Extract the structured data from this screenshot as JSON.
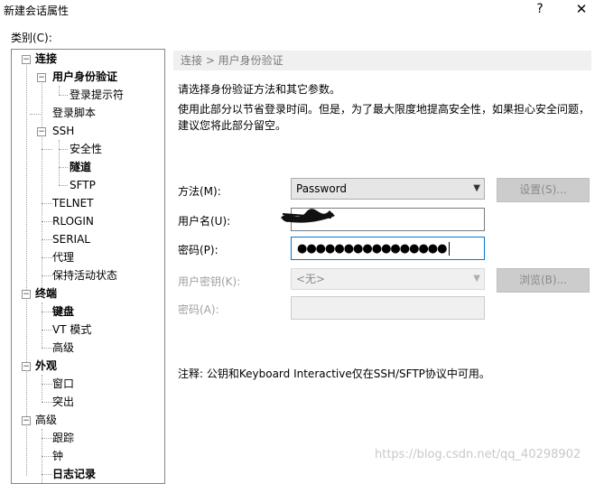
{
  "window": {
    "title": "新建会话属性",
    "help": "?",
    "close": "✕"
  },
  "category_label": "类别(C):",
  "tree": {
    "items": [
      {
        "label": "连接",
        "bold": true
      },
      {
        "label": "用户身份验证",
        "bold": true,
        "selected": true
      },
      {
        "label": "登录提示符"
      },
      {
        "label": "登录脚本"
      },
      {
        "label": "SSH"
      },
      {
        "label": "安全性"
      },
      {
        "label": "隧道",
        "bold": true
      },
      {
        "label": "SFTP"
      },
      {
        "label": "TELNET"
      },
      {
        "label": "RLOGIN"
      },
      {
        "label": "SERIAL"
      },
      {
        "label": "代理"
      },
      {
        "label": "保持活动状态"
      },
      {
        "label": "终端",
        "bold": true
      },
      {
        "label": "键盘",
        "bold": true
      },
      {
        "label": "VT 模式"
      },
      {
        "label": "高级"
      },
      {
        "label": "外观",
        "bold": true
      },
      {
        "label": "窗口"
      },
      {
        "label": "突出"
      },
      {
        "label": "高级"
      },
      {
        "label": "跟踪"
      },
      {
        "label": "钟"
      },
      {
        "label": "日志记录"
      }
    ]
  },
  "panel": {
    "breadcrumb": "连接 > 用户身份验证",
    "desc1": "请选择身份验证方法和其它参数。",
    "desc2": "使用此部分以节省登录时间。但是，为了最大限度地提高安全性，如果担心安全问题，",
    "desc3": "建议您将此部分留空。",
    "method_label": "方法(M):",
    "method_value": "Password",
    "settings_button": "设置(S)...",
    "username_label": "用户名(U):",
    "password_label": "密码(P):",
    "password_value": "●●●●●●●●●●●●●●●●",
    "userkey_label": "用户密钥(K):",
    "userkey_value": "<无>",
    "browse_button": "浏览(B)...",
    "passphrase_label": "密码(A):",
    "note": "注释: 公钥和Keyboard Interactive仅在SSH/SFTP协议中可用。"
  },
  "watermark": "https://blog.csdn.net/qq_40298902"
}
